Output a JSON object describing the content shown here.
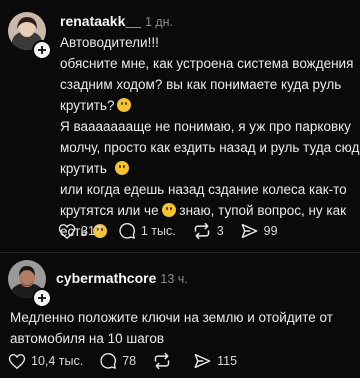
{
  "posts": [
    {
      "username": "renataakk__",
      "time": "1 дн.",
      "lines": [
        "Автоводители!!!",
        "обясните мне, как устроена система вождения",
        "сзадним ходом? вы как понимаете куда руль",
        "крутить?",
        "Я ваааааааще не понимаю, я уж про парковку",
        "молчу, просто как ездить назад и руль туда сюда",
        "крутить",
        "или когда едешь назад сздание колеса как-то",
        "крутятся или че",
        "знаю, тупой вопрос, ну как",
        "есть"
      ],
      "stats": {
        "likes": "317",
        "comments": "1 тыс.",
        "reposts": "3",
        "shares": "99"
      }
    },
    {
      "username": "cybermathcore",
      "time": "13 ч.",
      "lines": [
        "Медленно положите ключи на землю и отойдите от",
        "автомобиля на 10 шагов"
      ],
      "stats": {
        "likes": "10,4 тыс.",
        "comments": "78",
        "reposts": "",
        "shares": "115"
      }
    }
  ],
  "colors": {
    "background": "#0a0a0a",
    "text": "#eaeaea",
    "muted": "#8a8a8a",
    "emoji": "#f4c430"
  },
  "icons": [
    "heart-icon",
    "comment-icon",
    "repost-icon",
    "share-icon",
    "plus-icon",
    "emoji-icon"
  ]
}
